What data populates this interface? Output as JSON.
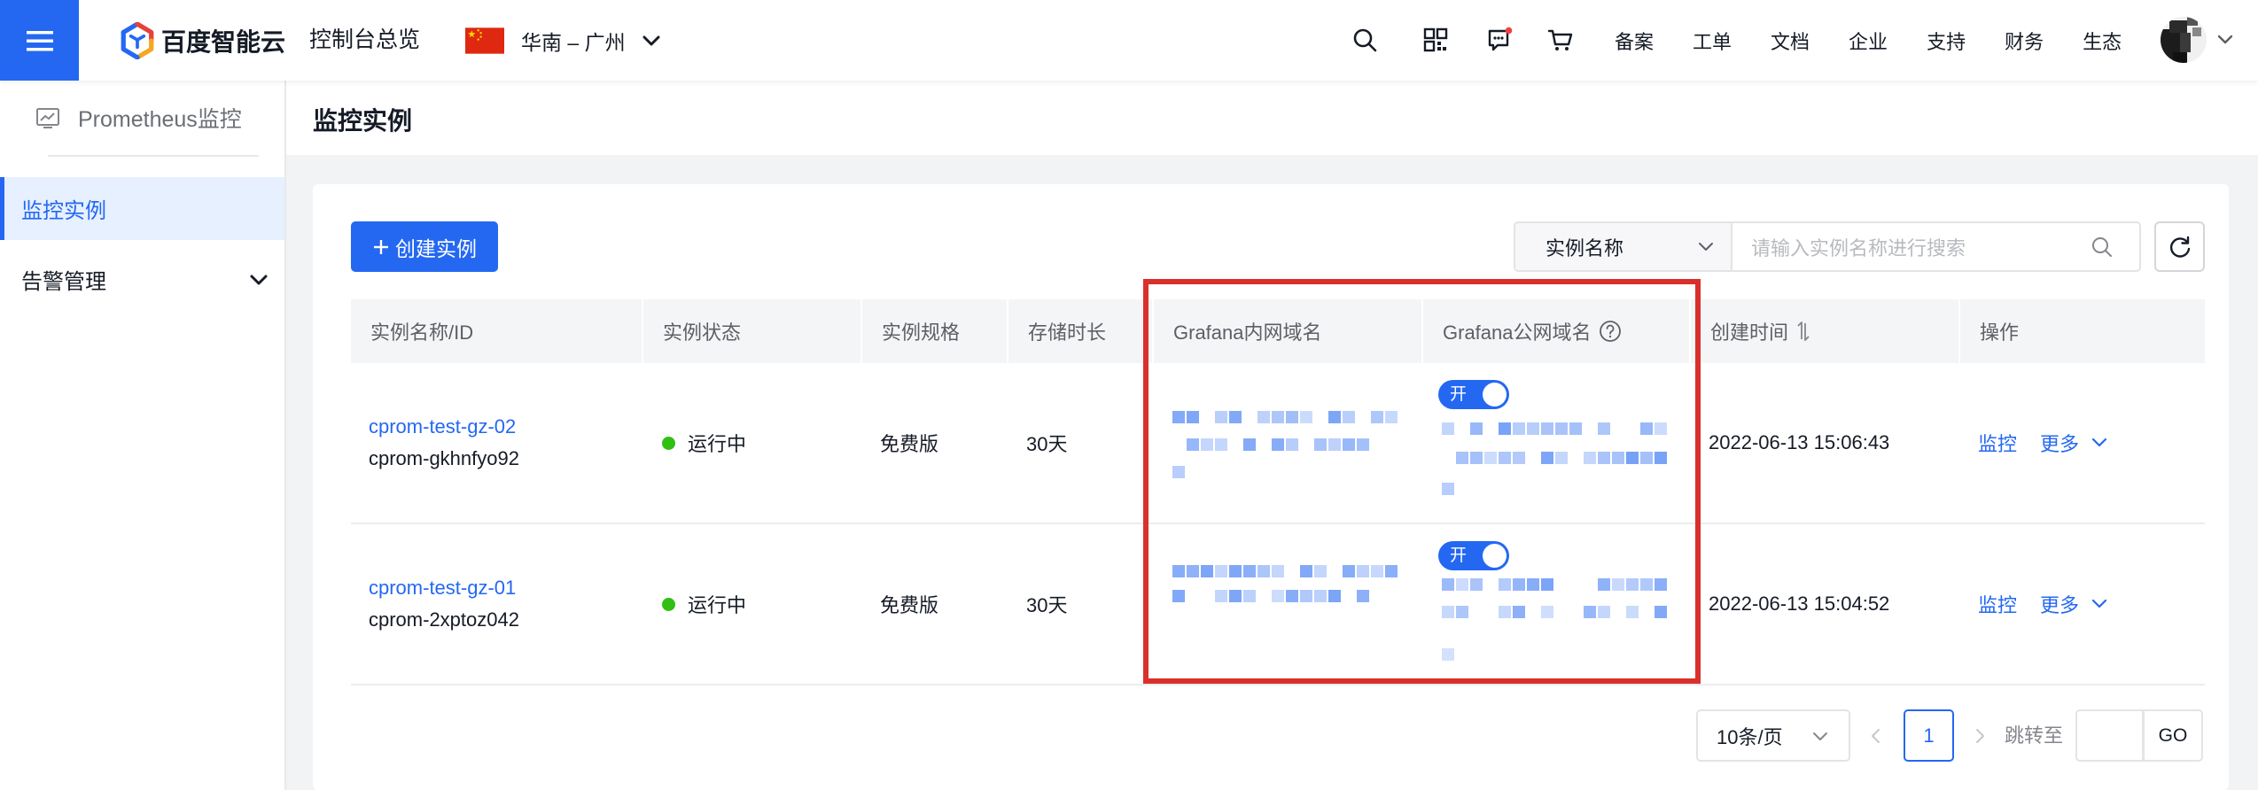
{
  "topbar": {
    "brand": "百度智能云",
    "console_overview": "控制台总览",
    "region": "华南 – 广州",
    "nav": [
      "备案",
      "工单",
      "文档",
      "企业",
      "支持",
      "财务",
      "生态"
    ],
    "icons": [
      "menu-icon",
      "baidu-cloud-logo-icon",
      "china-flag-icon",
      "search-icon",
      "qrcode-icon",
      "message-icon",
      "cart-icon",
      "avatar",
      "chevron-down-icon"
    ]
  },
  "sidebar": {
    "product": "Prometheus监控",
    "items": [
      {
        "label": "监控实例",
        "active": true
      },
      {
        "label": "告警管理",
        "active": false
      }
    ]
  },
  "page": {
    "title": "监控实例"
  },
  "toolbar": {
    "create_label": "创建实例",
    "filter_select": "实例名称",
    "search_placeholder": "请输入实例名称进行搜索"
  },
  "table": {
    "columns": [
      "实例名称/ID",
      "实例状态",
      "实例规格",
      "存储时长",
      "Grafana内网域名",
      "Grafana公网域名",
      "创建时间",
      "操作"
    ],
    "rows": [
      {
        "name": "cprom-test-gz-02",
        "id": "cprom-gkhnfyo92",
        "status": "运行中",
        "spec": "免费版",
        "retention": "30天",
        "public_domain_switch": "开",
        "created_at": "2022-06-13 15:06:43",
        "actions": [
          "监控",
          "更多"
        ]
      },
      {
        "name": "cprom-test-gz-01",
        "id": "cprom-2xptoz042",
        "status": "运行中",
        "spec": "免费版",
        "retention": "30天",
        "public_domain_switch": "开",
        "created_at": "2022-06-13 15:04:52",
        "actions": [
          "监控",
          "更多"
        ]
      }
    ]
  },
  "pagination": {
    "page_size": "10条/页",
    "current_page": "1",
    "jump_label": "跳转至",
    "go_label": "GO"
  },
  "colors": {
    "primary": "#2468f2",
    "running": "#30bf13",
    "highlight_border": "#d9302c",
    "page_background": "#f2f3f5",
    "sidebar_active_bg": "#e6f0ff"
  }
}
